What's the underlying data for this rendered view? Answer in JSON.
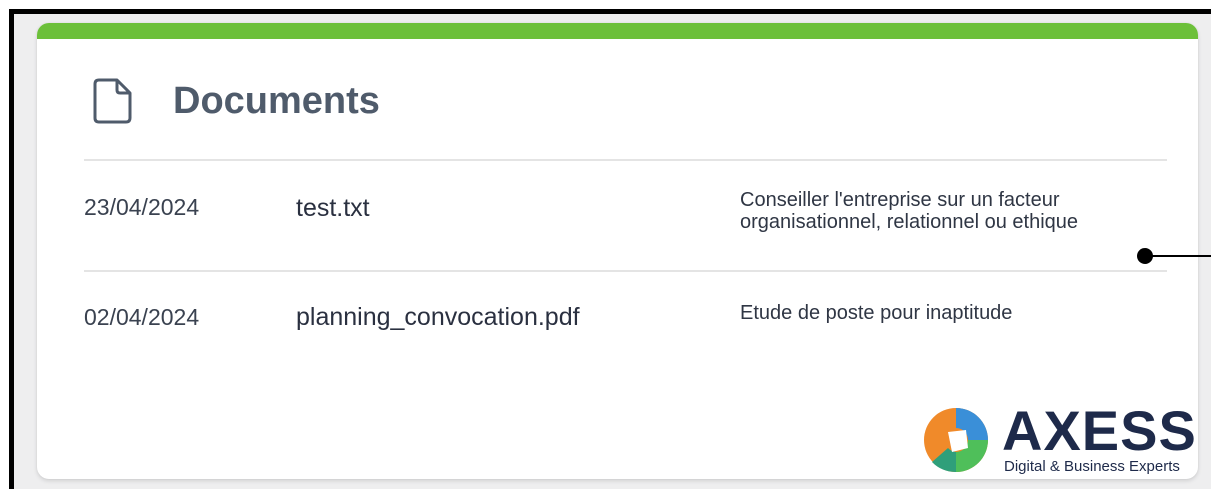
{
  "card": {
    "title": "Documents",
    "icon": "document-icon",
    "accent_color": "#6cc03a"
  },
  "documents": [
    {
      "date": "23/04/2024",
      "filename": "test.txt",
      "description_line1": "Conseiller l'entreprise sur un facteur",
      "description_line2": "organisationnel, relationnel ou ethique"
    },
    {
      "date": "02/04/2024",
      "filename": "planning_convocation.pdf",
      "description_line1": "Etude de poste pour inaptitude",
      "description_line2": ""
    }
  ],
  "logo": {
    "name": "AXESS",
    "tagline": "Digital & Business Experts"
  }
}
